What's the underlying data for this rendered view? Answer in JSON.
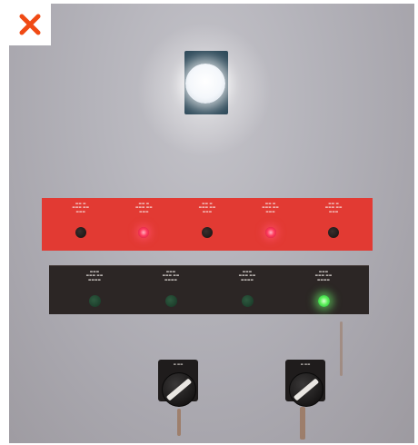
{
  "close_button": {
    "icon": "close-icon",
    "color": "#f04a14"
  },
  "pilot_light": {
    "color": "#ffffff",
    "state": "on"
  },
  "red_strip": {
    "background": "#e23a33",
    "indicators": [
      {
        "led": "off"
      },
      {
        "led": "red-on"
      },
      {
        "led": "off"
      },
      {
        "led": "red-on"
      },
      {
        "led": "off"
      }
    ]
  },
  "dark_strip": {
    "background": "#2c2625",
    "indicators": [
      {
        "led": "green-off"
      },
      {
        "led": "green-off"
      },
      {
        "led": "green-off"
      },
      {
        "led": "green-on"
      }
    ]
  },
  "selector_switches": [
    {
      "position": "left"
    },
    {
      "position": "right"
    }
  ]
}
